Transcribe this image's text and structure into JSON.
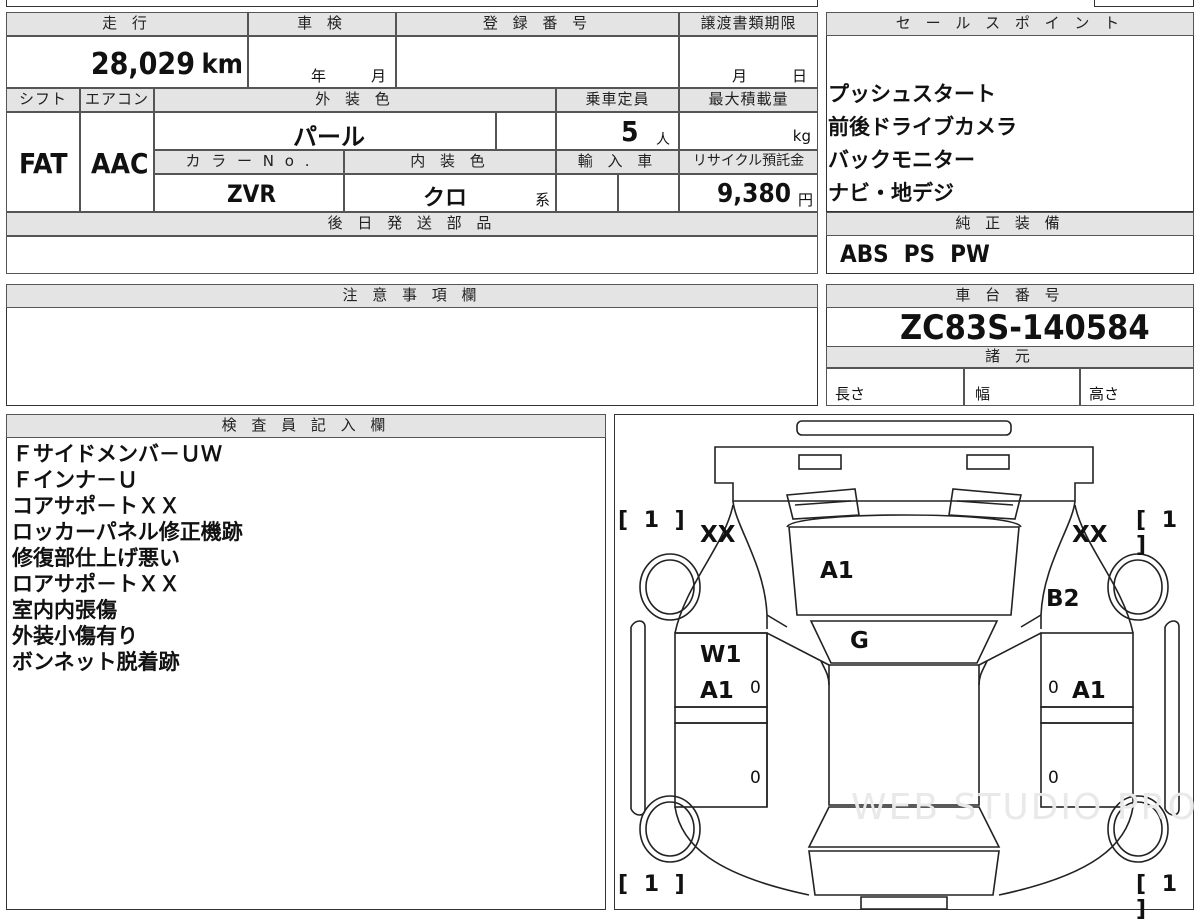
{
  "top": {
    "headers": {
      "mileage": "走 行",
      "inspection": "車 検",
      "registration": "登 録 番 号",
      "transfer_deadline": "譲渡書類期限",
      "sales_points": "セ ー ル ス ポ イ ン ト"
    },
    "mileage_value": "28,029",
    "mileage_unit": "km",
    "inspection_year": "年",
    "inspection_month": "月",
    "deadline_month": "月",
    "deadline_day": "日"
  },
  "spec": {
    "shift_label": "シフト",
    "ac_label": "エアコン",
    "exterior_label": "外 装 色",
    "capacity_label": "乗車定員",
    "max_load_label": "最大積載量",
    "shift_value": "FAT",
    "ac_value": "AAC",
    "exterior_value": "パール",
    "capacity_value": "5",
    "capacity_unit": "人",
    "max_load_unit": "kg",
    "color_no_label": "カ ラ ー N o .",
    "interior_label": "内 装 色",
    "import_label": "輸 入 車",
    "recycle_label": "リサイクル預託金",
    "color_no_value": "ZVR",
    "interior_value": "クロ",
    "interior_suffix": "系",
    "recycle_value": "9,380",
    "recycle_unit": "円",
    "later_parts_label": "後 日 発 送 部 品"
  },
  "sales_points": [
    "プッシュスタート",
    "前後ドライブカメラ",
    "バックモニター",
    "ナビ・地デジ"
  ],
  "equipment": {
    "label": "純 正 装 備",
    "value": "ABS  PS  PW"
  },
  "notes_label": "注 意 事 項 欄",
  "chassis": {
    "label": "車 台 番 号",
    "value": "ZC83S-140584",
    "specs_label": "諸 元",
    "length_label": "長さ",
    "width_label": "幅",
    "height_label": "高さ"
  },
  "inspector": {
    "label": "検 査 員 記 入 欄",
    "lines": [
      "Ｆサイドメンバ－ＵＷ",
      "Ｆインナ－Ｕ",
      "コアサポ－トＸＸ",
      "ロッカーパネル修正機跡",
      "修復部仕上げ悪い",
      "ロアサポ－トＸＸ",
      "室内内張傷",
      "外装小傷有り",
      "ボンネット脱着跡"
    ]
  },
  "diagram": {
    "marks": {
      "front_left": "XX",
      "front_right": "XX",
      "hood": "A1",
      "right_fender": "B2",
      "windshield": "G",
      "left_front_door_1": "W1",
      "left_front_door_2": "A1",
      "right_front_door": "A1"
    },
    "tire_brackets": [
      "[ 1 ]",
      "[ 1 ]",
      "[ 1 ]",
      "[ 1 ]"
    ],
    "zeros": [
      "0",
      "0",
      "0",
      "0"
    ],
    "watermark": "WEB STUDIO PRO"
  }
}
